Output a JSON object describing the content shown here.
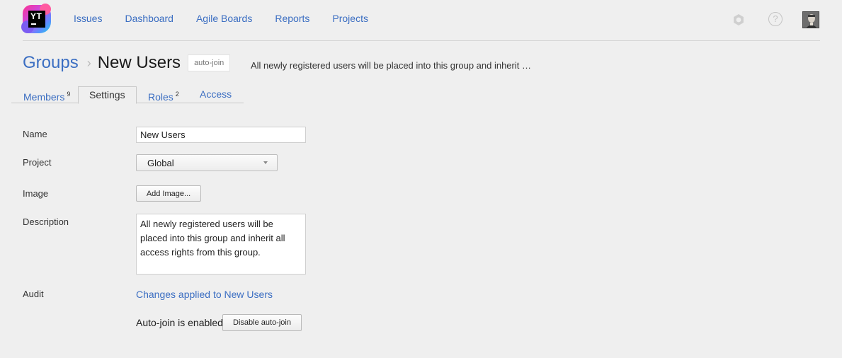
{
  "app": {
    "logo_text": "YT"
  },
  "nav": {
    "items": [
      {
        "label": "Issues"
      },
      {
        "label": "Dashboard"
      },
      {
        "label": "Agile Boards"
      },
      {
        "label": "Reports"
      },
      {
        "label": "Projects"
      }
    ]
  },
  "header": {
    "breadcrumb_parent": "Groups",
    "breadcrumb_separator": "›",
    "title": "New Users",
    "badge": "auto-join",
    "description": "All newly registered users will be placed into this group and inherit …"
  },
  "tabs": [
    {
      "label": "Members",
      "count": "9",
      "active": false
    },
    {
      "label": "Settings",
      "count": "",
      "active": true
    },
    {
      "label": "Roles",
      "count": "2",
      "active": false
    },
    {
      "label": "Access",
      "count": "",
      "active": false
    }
  ],
  "form": {
    "name": {
      "label": "Name",
      "value": "New Users"
    },
    "project": {
      "label": "Project",
      "value": "Global"
    },
    "image": {
      "label": "Image",
      "button": "Add Image..."
    },
    "description": {
      "label": "Description",
      "value": "All newly registered users will be placed into this group and inherit all access rights from this group."
    },
    "audit": {
      "label": "Audit",
      "link": "Changes applied to New Users"
    },
    "autojoin": {
      "status": "Auto-join is enabled",
      "button": "Disable auto-join"
    }
  },
  "icons": {
    "settings": "gear-icon",
    "help": "help-icon",
    "user": "avatar",
    "project_dropdown": "chevron-down-icon"
  },
  "colors": {
    "background": "#efefef",
    "link": "#3b6ec2",
    "text": "#333333"
  }
}
